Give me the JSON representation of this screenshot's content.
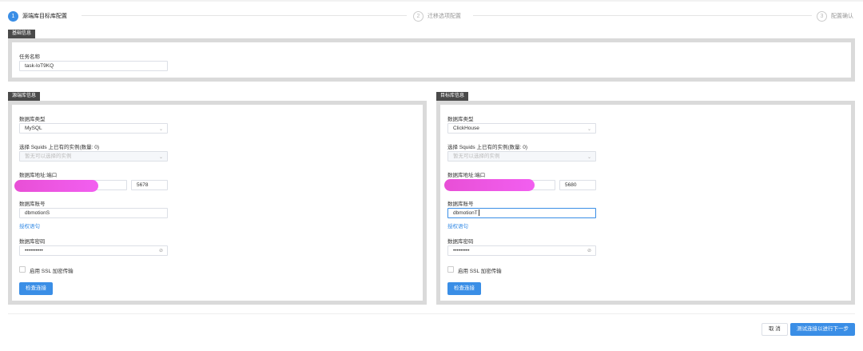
{
  "steps": [
    {
      "num": "1",
      "label": "源端库目标库配置",
      "state": "active"
    },
    {
      "num": "2",
      "label": "迁移选项配置",
      "state": "inactive"
    },
    {
      "num": "3",
      "label": "配置确认",
      "state": "inactive"
    }
  ],
  "basic": {
    "tag": "基础信息",
    "task_name_label": "任务名称",
    "task_name_value": "task-loT9KQ"
  },
  "source": {
    "tag": "源端库信息",
    "db_type_label": "数据库类型",
    "db_type_value": "MySQL",
    "instance_label": "选择 Squids 上已有的实例(数量: 0)",
    "instance_placeholder": "暂无可以选择的实例",
    "addr_label": "数据库地址:端口",
    "port_value": "5678",
    "account_label": "数据库账号",
    "account_value": "dbmotionS",
    "grant_link": "授权语句",
    "password_label": "数据库密码",
    "password_value": "••••••••••",
    "ssl_label": "启用 SSL 加密传输",
    "check_button": "检查连接"
  },
  "target": {
    "tag": "目标库信息",
    "db_type_label": "数据库类型",
    "db_type_value": "ClickHouse",
    "instance_label": "选择 Squids 上已有的实例(数量: 0)",
    "instance_placeholder": "暂无可以选择的实例",
    "addr_label": "数据库地址:端口",
    "port_value": "5680",
    "account_label": "数据库账号",
    "account_value": "dbmotionT",
    "grant_link": "授权语句",
    "password_label": "数据库密码",
    "password_value": "•••••••••",
    "ssl_label": "启用 SSL 加密传输",
    "check_button": "检查连接"
  },
  "footer": {
    "cancel_button": "取 消",
    "next_button": "测试连接以进行下一步"
  },
  "icons": {
    "chevron": "chevron-down-icon",
    "eye": "eye-off-icon"
  },
  "colors": {
    "primary": "#3a8ee6",
    "tag_bg": "#4a4a4a",
    "frame": "#dadada",
    "redaction": "#ee55e4"
  }
}
